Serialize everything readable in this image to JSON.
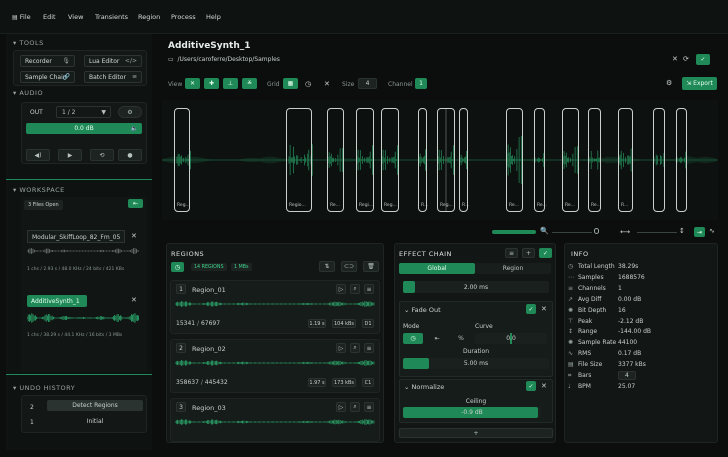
{
  "menu": [
    "File",
    "Edit",
    "View",
    "Transients",
    "Region",
    "Process",
    "Help"
  ],
  "tools": {
    "title": "TOOLS",
    "buttons": [
      {
        "label": "Recorder",
        "icon": "mic-icon",
        "glyph": "🎙"
      },
      {
        "label": "Lua Editor",
        "icon": "code-icon",
        "glyph": "</>"
      },
      {
        "label": "Sample Chain",
        "icon": "link-icon",
        "glyph": "🔗"
      },
      {
        "label": "Batch Editor",
        "icon": "list-icon",
        "glyph": "≡"
      }
    ]
  },
  "audio": {
    "title": "AUDIO",
    "out_label": "OUT",
    "out_value": "1 / 2",
    "gain": "0.0 dB"
  },
  "workspace": {
    "title": "WORKSPACE",
    "files_badge": "3 Files Open",
    "files": [
      {
        "name": "Modular_SkiffLoop_82_Fm_05",
        "meta": "1 chs / 2.93 s / 48.0 KHz / 24 bits / 421 KBs",
        "active": false
      },
      {
        "name": "AdditiveSynth_1",
        "meta": "1 chs / 38.29 s / 44.1 KHz / 16 bits / 3 MBs",
        "active": true
      }
    ]
  },
  "undo": {
    "title": "UNDO HISTORY",
    "items": [
      {
        "index": "2",
        "label": "Detect Regions"
      },
      {
        "index": "1",
        "label": "Initial"
      }
    ]
  },
  "file": {
    "title": "AdditiveSynth_1",
    "path": "/Users/caroferre/Desktop/Samples"
  },
  "toolbar": {
    "view_label": "View",
    "grid_label": "Grid",
    "size_label": "Size",
    "size_value": "4",
    "channel_label": "Channel",
    "channel_value": "1",
    "export_label": "Export"
  },
  "waveform_regions": [
    {
      "label": "Reg..."
    },
    {
      "label": "Regio..."
    },
    {
      "label": "Re..."
    },
    {
      "label": "Regi..."
    },
    {
      "label": "Reg..."
    },
    {
      "label": "R..."
    },
    {
      "label": "Reg..."
    },
    {
      "label": "R..."
    },
    {
      "label": "Re..."
    },
    {
      "label": "Re..."
    },
    {
      "label": "Re..."
    },
    {
      "label": "Re..."
    },
    {
      "label": "R..."
    }
  ],
  "regions": {
    "title": "REGIONS",
    "count_badge": "14 REGIONS",
    "size_badge": "1 MBs",
    "items": [
      {
        "num": "1",
        "name": "Region_01",
        "start": "15341",
        "end": "67697",
        "duration": "1.19 s",
        "size": "104 kBs",
        "note": "D1"
      },
      {
        "num": "2",
        "name": "Region_02",
        "start": "358637",
        "end": "445432",
        "duration": "1.97 s",
        "size": "173 kBs",
        "note": "C1"
      },
      {
        "num": "3",
        "name": "Region_03",
        "start": "",
        "end": "",
        "duration": "",
        "size": "",
        "note": ""
      }
    ]
  },
  "effects": {
    "title": "EFFECT CHAIN",
    "tabs": [
      "Global",
      "Region"
    ],
    "top_value": "2.00 ms",
    "top_fill": 0.08,
    "fade_out": {
      "title": "Fade Out",
      "mode_label": "Mode",
      "curve_label": "Curve",
      "curve_value": "0.0",
      "duration_label": "Duration",
      "duration_value": "5.00 ms",
      "duration_fill": 0.18
    },
    "normalize": {
      "title": "Normalize",
      "ceiling_label": "Ceiling",
      "ceiling_value": "-0.9 dB",
      "ceiling_fill": 0.98
    },
    "add_label": "+"
  },
  "info": {
    "title": "INFO",
    "rows": [
      {
        "icon": "clock-icon",
        "glyph": "◷",
        "label": "Total Length",
        "value": "38.29s"
      },
      {
        "icon": "samples-icon",
        "glyph": "⋯",
        "label": "Samples",
        "value": "1688576"
      },
      {
        "icon": "channels-icon",
        "glyph": "≡",
        "label": "Channels",
        "value": "1"
      },
      {
        "icon": "diff-icon",
        "glyph": "↗",
        "label": "Avg Diff",
        "value": "0.00 dB"
      },
      {
        "icon": "gear-icon",
        "glyph": "✺",
        "label": "Bit Depth",
        "value": "16"
      },
      {
        "icon": "peak-icon",
        "glyph": "⊤",
        "label": "Peak",
        "value": "-2.12 dB"
      },
      {
        "icon": "range-icon",
        "glyph": "↕",
        "label": "Range",
        "value": "-144.00 dB"
      },
      {
        "icon": "rate-icon",
        "glyph": "✺",
        "label": "Sample Rate",
        "value": "44100"
      },
      {
        "icon": "rms-icon",
        "glyph": "∿",
        "label": "RMS",
        "value": "0.17 dB"
      },
      {
        "icon": "filesize-icon",
        "glyph": "▤",
        "label": "File Size",
        "value": "3377 kBs"
      },
      {
        "icon": "bars-icon",
        "glyph": "⌗",
        "label": "Bars",
        "value": "4"
      },
      {
        "icon": "bpm-icon",
        "glyph": "♩",
        "label": "BPM",
        "value": "25.07"
      }
    ]
  },
  "colors": {
    "accent": "#1f8a57",
    "waveform": "#2fbf7a",
    "bg": "#0b0e0d"
  }
}
